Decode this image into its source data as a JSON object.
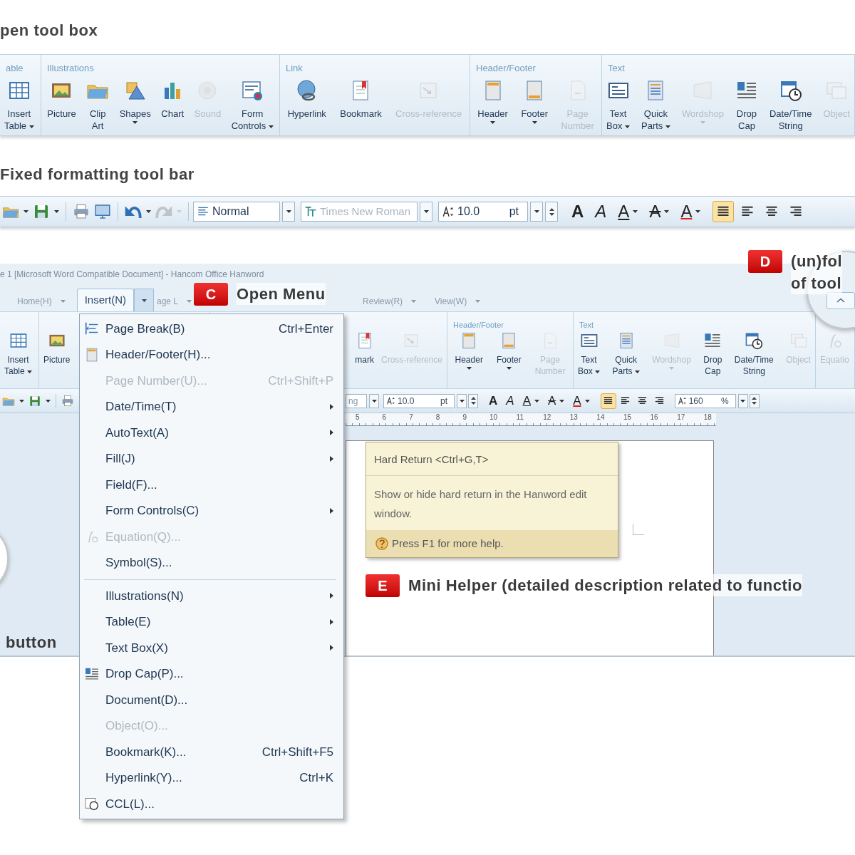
{
  "toolbox_heading": "pen tool box",
  "toolbox": {
    "groups": [
      {
        "title": "able",
        "buttons": [
          {
            "label": "Insert\nTable",
            "disabled": false,
            "dropdown": true
          }
        ]
      },
      {
        "title": "Illustrations",
        "buttons": [
          {
            "label": "Picture",
            "disabled": false,
            "dropdown": false
          },
          {
            "label": "Clip\nArt",
            "disabled": false,
            "dropdown": false
          },
          {
            "label": "Shapes",
            "disabled": false,
            "dropdown": true
          },
          {
            "label": "Chart",
            "disabled": false,
            "dropdown": false
          },
          {
            "label": "Sound",
            "disabled": true,
            "dropdown": false
          },
          {
            "label": "Form\nControls",
            "disabled": false,
            "dropdown": true
          }
        ]
      },
      {
        "title": "Link",
        "buttons": [
          {
            "label": "Hyperlink",
            "disabled": false,
            "dropdown": false
          },
          {
            "label": "Bookmark",
            "disabled": false,
            "dropdown": false
          },
          {
            "label": "Cross-reference",
            "disabled": true,
            "dropdown": false
          }
        ]
      },
      {
        "title": "Header/Footer",
        "buttons": [
          {
            "label": "Header",
            "disabled": false,
            "dropdown": true
          },
          {
            "label": "Footer",
            "disabled": false,
            "dropdown": true
          },
          {
            "label": "Page\nNumber",
            "disabled": true,
            "dropdown": false
          }
        ]
      },
      {
        "title": "Text",
        "buttons": [
          {
            "label": "Text\nBox",
            "disabled": false,
            "dropdown": true
          },
          {
            "label": "Quick\nParts",
            "disabled": false,
            "dropdown": true
          },
          {
            "label": "Wordshop",
            "disabled": true,
            "dropdown": true
          },
          {
            "label": "Drop\nCap",
            "disabled": false,
            "dropdown": false
          },
          {
            "label": "Date/Time\nString",
            "disabled": false,
            "dropdown": false
          },
          {
            "label": "Object",
            "disabled": true,
            "dropdown": false
          }
        ]
      }
    ]
  },
  "formatting_heading": "Fixed formatting tool bar",
  "formatting_bar": {
    "quick_buttons": [
      {
        "disabled": false,
        "dropdown": true
      },
      {
        "disabled": false,
        "dropdown": true
      },
      {
        "disabled": false,
        "dropdown": false
      },
      {
        "disabled": false,
        "dropdown": false
      },
      {
        "disabled": false,
        "dropdown": true
      },
      {
        "disabled": true,
        "dropdown": true
      }
    ],
    "style": {
      "value": "Normal",
      "disabled": false
    },
    "font": {
      "value": "Times New Roman",
      "disabled": true
    },
    "size": {
      "value": "10.0",
      "unit": "pt"
    },
    "text_buttons": [
      {
        "label": "A",
        "kind": "bold",
        "dropdown": false
      },
      {
        "label": "A",
        "kind": "italic",
        "dropdown": false
      },
      {
        "label": "A",
        "kind": "underline",
        "dropdown": true
      },
      {
        "label": "A",
        "kind": "strike",
        "dropdown": true
      },
      {
        "label": "A",
        "kind": "color",
        "dropdown": true
      }
    ],
    "align_buttons": [
      {
        "selected": true
      },
      {
        "selected": false
      },
      {
        "selected": false
      },
      {
        "selected": false
      }
    ]
  },
  "window": {
    "title": "e 1 [Microsoft Word Compatible Document] - Hancom Office Hanword",
    "tabs": [
      {
        "label": "Home(H)",
        "selected": false
      },
      {
        "label": "Insert(N)",
        "selected": true
      },
      {
        "label": "age L",
        "selected": false
      },
      {
        "label": "Review(R)",
        "selected": false
      },
      {
        "label": "View(W)",
        "selected": false
      }
    ],
    "ribbon": {
      "groups": [
        {
          "buttons": [
            {
              "label": "Insert\nTable",
              "disabled": false,
              "dropdown": true
            }
          ]
        },
        {
          "buttons": [
            {
              "label": "Picture",
              "disabled": false,
              "dropdown": false
            }
          ]
        },
        {
          "buttons": [
            {
              "label": "mark",
              "disabled": false,
              "dropdown": false
            },
            {
              "label": "Cross-reference",
              "disabled": true,
              "dropdown": false
            }
          ]
        },
        {
          "title": "Header/Footer",
          "buttons": [
            {
              "label": "Header",
              "disabled": false,
              "dropdown": true
            },
            {
              "label": "Footer",
              "disabled": false,
              "dropdown": true
            },
            {
              "label": "Page\nNumber",
              "disabled": true,
              "dropdown": false
            }
          ]
        },
        {
          "title": "Text",
          "buttons": [
            {
              "label": "Text\nBox",
              "disabled": false,
              "dropdown": true
            },
            {
              "label": "Quick\nParts",
              "disabled": false,
              "dropdown": true
            },
            {
              "label": "Wordshop",
              "disabled": true,
              "dropdown": true
            },
            {
              "label": "Drop\nCap",
              "disabled": false,
              "dropdown": false
            },
            {
              "label": "Date/Time\nString",
              "disabled": false,
              "dropdown": false
            },
            {
              "label": "Object",
              "disabled": true,
              "dropdown": false
            }
          ]
        },
        {
          "buttons": [
            {
              "label": "Equatio",
              "disabled": true,
              "dropdown": false
            }
          ]
        }
      ]
    },
    "formatting_bar": {
      "quick_buttons": [
        {
          "disabled": false,
          "dropdown": true
        },
        {
          "disabled": false,
          "dropdown": true
        },
        {
          "disabled": false,
          "dropdown": false
        }
      ],
      "style": {
        "value": "ng"
      },
      "size": {
        "value": "10.0",
        "unit": "pt"
      },
      "text_buttons": [
        {
          "label": "A",
          "kind": "bold",
          "dropdown": false
        },
        {
          "label": "A",
          "kind": "italic",
          "dropdown": false
        },
        {
          "label": "A",
          "kind": "underline",
          "dropdown": true
        },
        {
          "label": "A",
          "kind": "strike",
          "dropdown": true
        },
        {
          "label": "A",
          "kind": "color",
          "dropdown": true
        }
      ],
      "align_buttons": [
        {
          "selected": true
        },
        {
          "selected": false
        },
        {
          "selected": false
        },
        {
          "selected": false
        }
      ],
      "zoom": {
        "value": "160",
        "unit": "%"
      }
    },
    "ruler": [
      "5",
      "6",
      "7",
      "8",
      "9",
      "10",
      "11",
      "12",
      "13",
      "14",
      "15",
      "16",
      "17",
      "18"
    ],
    "tooltip": {
      "title": "Hard Return <Ctrl+G,T>",
      "body": "Show or hide hard return in the Hanword edit window.",
      "help": "Press F1 for more help."
    },
    "edge_label": "button",
    "menu": {
      "items": [
        {
          "kind": "item",
          "label": "Page Break(B)",
          "shortcut": "Ctrl+Enter",
          "disabled": false,
          "submenu": false
        },
        {
          "kind": "item",
          "label": "Header/Footer(H)...",
          "disabled": false,
          "submenu": false
        },
        {
          "kind": "item",
          "label": "Page Number(U)...",
          "shortcut": "Ctrl+Shift+P",
          "disabled": true,
          "submenu": false
        },
        {
          "kind": "item",
          "label": "Date/Time(T)",
          "disabled": false,
          "submenu": true
        },
        {
          "kind": "item",
          "label": "AutoText(A)",
          "disabled": false,
          "submenu": true
        },
        {
          "kind": "item",
          "label": "Fill(J)",
          "disabled": false,
          "submenu": true
        },
        {
          "kind": "item",
          "label": "Field(F)...",
          "disabled": false,
          "submenu": false
        },
        {
          "kind": "item",
          "label": "Form Controls(C)",
          "disabled": false,
          "submenu": true
        },
        {
          "kind": "item",
          "label": "Equation(Q)...",
          "disabled": true,
          "submenu": false
        },
        {
          "kind": "item",
          "label": "Symbol(S)...",
          "disabled": false,
          "submenu": false
        },
        {
          "kind": "separator"
        },
        {
          "kind": "item",
          "label": "Illustrations(N)",
          "disabled": false,
          "submenu": true
        },
        {
          "kind": "item",
          "label": "Table(E)",
          "disabled": false,
          "submenu": true
        },
        {
          "kind": "item",
          "label": "Text Box(X)",
          "disabled": false,
          "submenu": true
        },
        {
          "kind": "item",
          "label": "Drop Cap(P)...",
          "disabled": false,
          "submenu": false
        },
        {
          "kind": "item",
          "label": "Document(D)...",
          "disabled": false,
          "submenu": false
        },
        {
          "kind": "item",
          "label": "Object(O)...",
          "disabled": true,
          "submenu": false
        },
        {
          "kind": "item",
          "label": "Bookmark(K)...",
          "shortcut": "Ctrl+Shift+F5",
          "disabled": false,
          "submenu": false
        },
        {
          "kind": "item",
          "label": "Hyperlink(Y)...",
          "shortcut": "Ctrl+K",
          "disabled": false,
          "submenu": false
        },
        {
          "kind": "item",
          "label": "CCL(L)...",
          "disabled": false,
          "submenu": false
        }
      ]
    }
  },
  "callouts": [
    {
      "letter": "C",
      "lines": [
        "Open Menu"
      ]
    },
    {
      "letter": "D",
      "lines": [
        "(un)fol",
        "of tool"
      ]
    },
    {
      "letter": "E",
      "lines": [
        "Mini Helper (detailed description related to functio"
      ]
    }
  ]
}
